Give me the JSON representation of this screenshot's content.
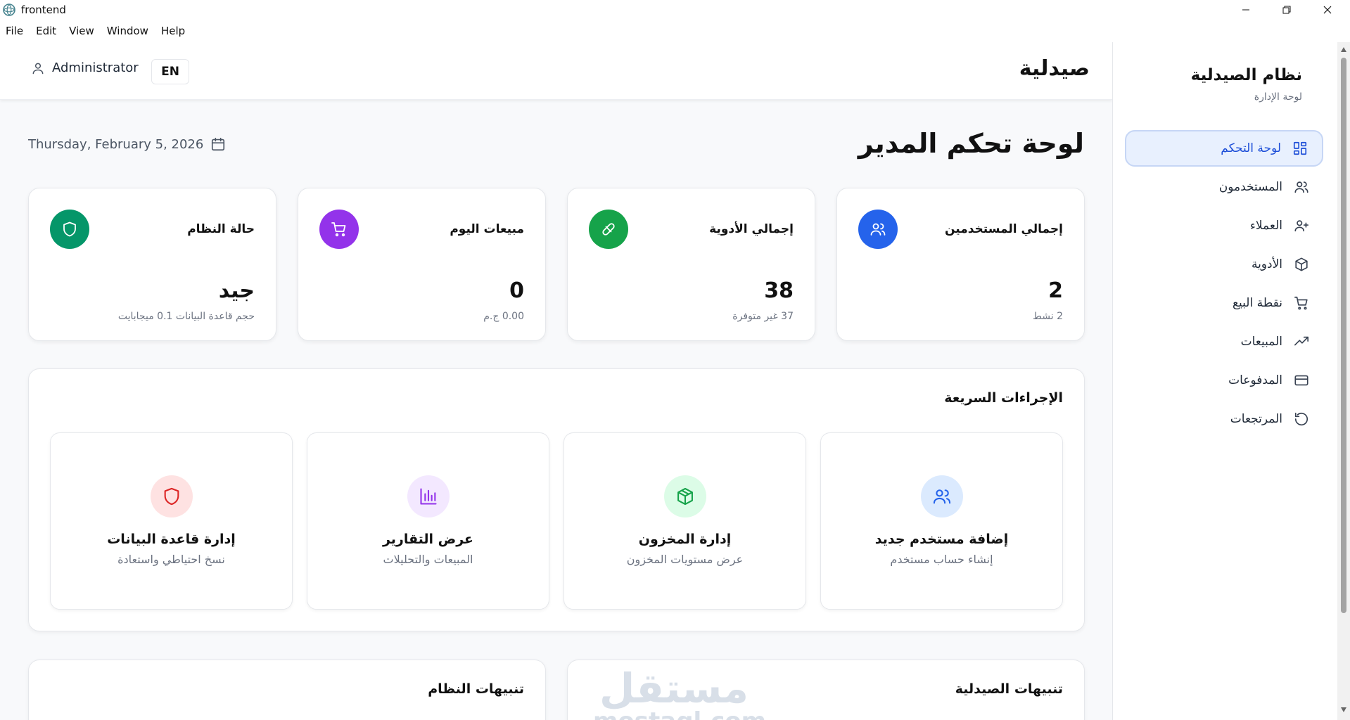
{
  "window": {
    "title": "frontend",
    "menu": [
      "File",
      "Edit",
      "View",
      "Window",
      "Help"
    ]
  },
  "header": {
    "user": "Administrator",
    "lang_button": "EN",
    "brand": "صيدلية"
  },
  "page": {
    "title": "لوحة تحكم المدير",
    "date": "Thursday, February 5, 2026"
  },
  "stats": [
    {
      "title": "إجمالي المستخدمين",
      "value": "2",
      "sub": "2 نشط",
      "icon": "users-icon",
      "color": "#2563eb"
    },
    {
      "title": "إجمالي الأدوية",
      "value": "38",
      "sub": "37 غير متوفرة",
      "icon": "pill-icon",
      "color": "#16a34a"
    },
    {
      "title": "مبيعات اليوم",
      "value": "0",
      "sub": "0.00 ج.م",
      "icon": "cart-icon",
      "color": "#9333ea"
    },
    {
      "title": "حالة النظام",
      "value": "جيد",
      "sub": "حجم قاعدة البيانات 0.1 ميجابايت",
      "icon": "shield-icon",
      "color": "#059669"
    }
  ],
  "quick_actions": {
    "title": "الإجراءات السريعة",
    "items": [
      {
        "title": "إضافة مستخدم جديد",
        "sub": "إنشاء حساب مستخدم",
        "icon": "users-icon",
        "color": "#2563eb",
        "bg": "#dbeafe"
      },
      {
        "title": "إدارة المخزون",
        "sub": "عرض مستويات المخزون",
        "icon": "box-icon",
        "color": "#16a34a",
        "bg": "#dcfce7"
      },
      {
        "title": "عرض التقارير",
        "sub": "المبيعات والتحليلات",
        "icon": "bar-chart-icon",
        "color": "#9333ea",
        "bg": "#f3e8ff"
      },
      {
        "title": "إدارة قاعدة البيانات",
        "sub": "نسخ احتياطي واستعادة",
        "icon": "shield-icon",
        "color": "#dc2626",
        "bg": "#fee2e2"
      }
    ]
  },
  "alerts": {
    "pharmacy": "تنبيهات الصيدلية",
    "system": "تنبيهات النظام"
  },
  "watermark": {
    "arabic": "مستقل",
    "latin": "mostaql.com"
  },
  "sidebar": {
    "app_name": "نظام الصيدلية",
    "app_sub": "لوحة الإدارة",
    "items": [
      {
        "label": "لوحة التحكم",
        "icon": "dashboard-icon",
        "active": true
      },
      {
        "label": "المستخدمون",
        "icon": "users-icon"
      },
      {
        "label": "العملاء",
        "icon": "user-plus-icon"
      },
      {
        "label": "الأدوية",
        "icon": "box-icon"
      },
      {
        "label": "نقطة البيع",
        "icon": "cart-icon"
      },
      {
        "label": "المبيعات",
        "icon": "trending-up-icon"
      },
      {
        "label": "المدفوعات",
        "icon": "credit-card-icon"
      },
      {
        "label": "المرتجعات",
        "icon": "undo-icon"
      }
    ]
  },
  "colors": {
    "accent": "#1d4ed8",
    "active_bg": "#e8f0fe"
  }
}
